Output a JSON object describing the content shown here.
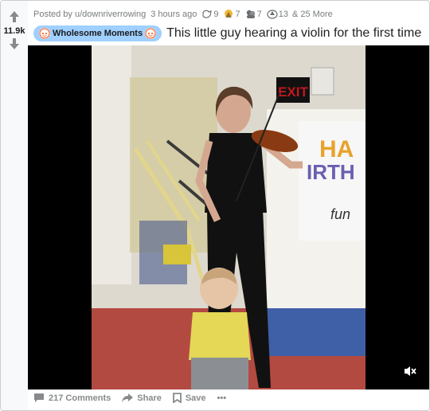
{
  "post": {
    "posted_by": "Posted by u/downriverrowing",
    "time": "3 hours ago",
    "awards": [
      {
        "icon": "helpful-award-icon",
        "count": "9"
      },
      {
        "icon": "wholesome-award-icon",
        "count": "7"
      },
      {
        "icon": "hugz-award-icon",
        "count": "7"
      },
      {
        "icon": "rocket-like-award-icon",
        "count": "13"
      }
    ],
    "more_awards": "& 25 More",
    "score": "11.9k",
    "flair": "Wholesome Moments",
    "title": "This little guy hearing a violin for the first time"
  },
  "sign": {
    "exit": "EXIT",
    "banner_line1": "HA",
    "banner_line2": "IRTH",
    "banner_line3": "fun"
  },
  "actions": {
    "comments": "217 Comments",
    "share": "Share",
    "save": "Save",
    "more": "•••"
  },
  "colors": {
    "flair_bg": "#9fd0ff",
    "meta": "#787c7e",
    "exit_sign": "#c0181e"
  }
}
